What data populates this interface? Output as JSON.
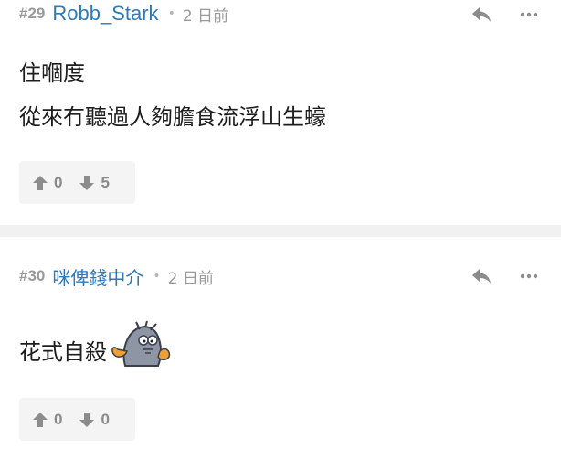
{
  "posts": [
    {
      "number": "#29",
      "username": "Robb_Stark",
      "separator": "•",
      "time": "2 日前",
      "content": [
        "住嗰度",
        "從來冇聽過人夠膽食流浮山生蠔"
      ],
      "upvotes": "0",
      "downvotes": "5"
    },
    {
      "number": "#30",
      "username": "咪俾錢中介",
      "separator": "•",
      "time": "2 日前",
      "content": [
        "花式自殺"
      ],
      "emoji": "seal-emoji",
      "upvotes": "0",
      "downvotes": "0"
    }
  ],
  "icons": {
    "reply": "reply-icon",
    "more": "more-icon",
    "upvote": "arrow-up-icon",
    "downvote": "arrow-down-icon"
  },
  "colors": {
    "username": "#2e79b9",
    "meta": "#9a9a9a",
    "icon": "#8c8c8c",
    "vote_bg": "#f4f4f4",
    "divider": "#f1f1f1"
  }
}
